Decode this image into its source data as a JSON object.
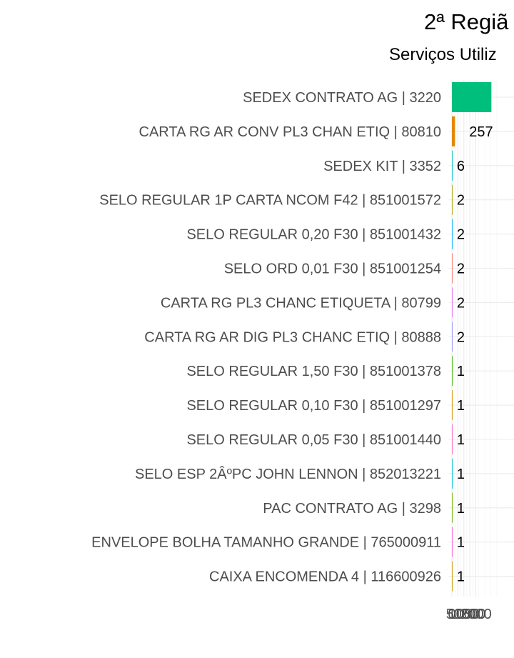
{
  "chart_data": {
    "type": "bar",
    "orientation": "horizontal",
    "title": "2ª Regiã",
    "subtitle": "Serviços Utiliz",
    "xlabel": "",
    "ylabel": "",
    "grid": true,
    "legend": "none",
    "xlim": [
      0,
      3400
    ],
    "xticks": [
      0,
      500,
      1000,
      1500,
      2000
    ],
    "categories": [
      "SEDEX CONTRATO AG | 3220",
      "CARTA RG AR CONV PL3 CHAN ETIQ | 80810",
      "SEDEX KIT | 3352",
      "SELO REGULAR 1P CARTA NCOM F42 | 851001572",
      "SELO REGULAR 0,20 F30 | 851001432",
      "SELO ORD 0,01 F30 | 851001254",
      "CARTA RG PL3 CHANC ETIQUETA | 80799",
      "CARTA RG AR DIG PL3 CHANC ETIQ | 80888",
      "SELO REGULAR 1,50 F30 | 851001378",
      "SELO REGULAR 0,10 F30 | 851001297",
      "SELO REGULAR 0,05 F30 | 851001440",
      "SELO ESP 2ÂºPC JOHN LENNON | 852013221",
      "PAC CONTRATO AG | 3298",
      "ENVELOPE BOLHA TAMANHO GRANDE | 765000911",
      "CAIXA ENCOMENDA 4 | 116600926"
    ],
    "values": [
      3300,
      257,
      6,
      2,
      2,
      2,
      2,
      2,
      1,
      1,
      1,
      1,
      1,
      1,
      1
    ],
    "labels": [
      "",
      "257",
      "6",
      "2",
      "2",
      "2",
      "2",
      "2",
      "1",
      "1",
      "1",
      "1",
      "1",
      "1",
      "1"
    ],
    "colors": [
      "#00BF7D",
      "#E58700",
      "#00BFC4",
      "#A3A500",
      "#00B0F6",
      "#F8766D",
      "#E76BF3",
      "#9590FF",
      "#39B600",
      "#D89000",
      "#FF62BC",
      "#00BCD8",
      "#6BB100",
      "#FD61D1",
      "#C99800"
    ]
  }
}
